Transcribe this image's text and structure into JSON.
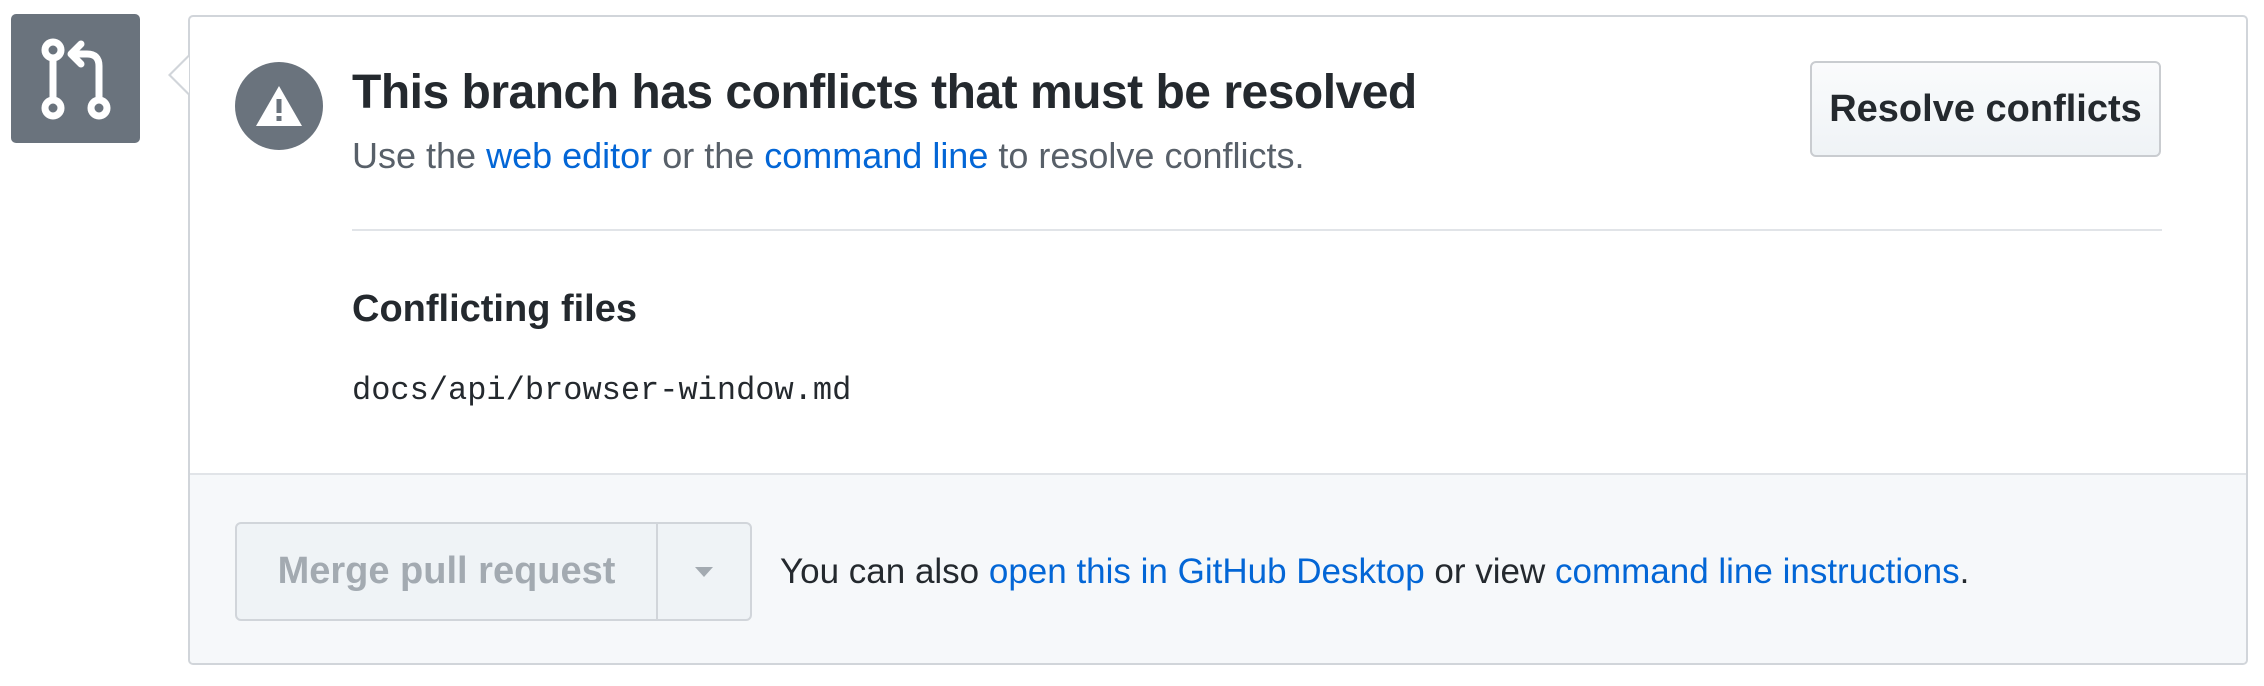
{
  "conflict": {
    "title": "This branch has conflicts that must be resolved",
    "subtitle": {
      "prefix": "Use the ",
      "link1": "web editor",
      "middle": " or the ",
      "link2": "command line",
      "suffix": " to resolve conflicts."
    },
    "resolve_button": "Resolve conflicts"
  },
  "conflicting_files": {
    "heading": "Conflicting files",
    "files": [
      "docs/api/browser-window.md"
    ]
  },
  "merge": {
    "button_label": "Merge pull request",
    "help": {
      "prefix": "You can also ",
      "link1": "open this in GitHub Desktop",
      "middle": " or view ",
      "link2": "command line instructions",
      "suffix": "."
    }
  },
  "icons": {
    "pull_request": "git-pull-request-icon",
    "alert": "alert-icon",
    "dropdown": "triangle-down-icon"
  },
  "colors": {
    "link": "#0366d6",
    "icon_bg": "#6a737d",
    "footer_bg": "#f6f8fa"
  }
}
